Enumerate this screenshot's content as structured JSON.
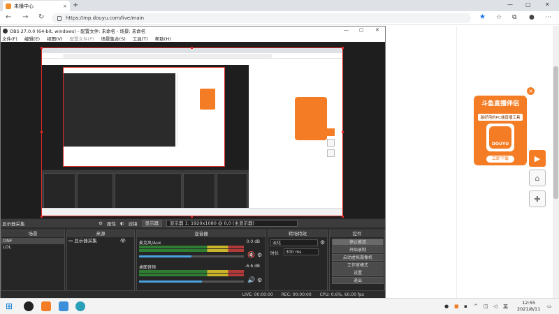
{
  "browser": {
    "tab_title": "未播中心",
    "url": "https://mp.douyu.com/live/main",
    "new_tab": "+",
    "tab_close": "×",
    "back": "←",
    "forward": "→",
    "reload": "↻",
    "star": "★"
  },
  "obs": {
    "title": "OBS 27.0.0 (64-bit, windows) - 配置文件: 未命名 - 场景: 未命名",
    "menu": [
      "文件(F)",
      "编辑(E)",
      "视图(V)",
      "配置文件(P)",
      "场景集合(S)",
      "工具(T)",
      "帮助(H)"
    ],
    "source_label": "显示器采集",
    "toolbar": {
      "properties": "属性",
      "filters": "滤镜",
      "display_label": "显示器",
      "display_value": "显示器 1: 1920x1080 @ 0,0 (主显示器)"
    },
    "scenes_header": "场景",
    "scenes": [
      "ONF",
      "LOL"
    ],
    "sources_header": "来源",
    "sources": [
      "显示器采集"
    ],
    "mixer_header": "混音器",
    "mixer": [
      {
        "name": "麦克风/Aux",
        "db": "0.0 dB",
        "level": 0.5
      },
      {
        "name": "桌面音频",
        "db": "-6.6 dB",
        "level": 0.6
      }
    ],
    "transitions_header": "转场特效",
    "transition_value": "淡化",
    "duration_label": "时长",
    "duration_value": "300 ms",
    "controls_header": "控件",
    "controls": [
      "停止推流",
      "开始录制",
      "启动虚拟摄像机",
      "工作室模式",
      "设置",
      "退出"
    ],
    "status": {
      "live": "LIVE: 00:00:00",
      "rec": "REC: 00:00:00",
      "cpu": "CPU: 0.6%, 60.00 fps"
    }
  },
  "promo": {
    "title": "斗鱼直播伴侣",
    "subtitle": "最好用的PC端直播工具",
    "logo_text": "DOUYU",
    "button": "立即下载",
    "close": "×"
  },
  "taskbar": {
    "time": "12:55",
    "date": "2021/8/11"
  },
  "colors": {
    "brand_orange": "#f47c24",
    "selection_red": "#e02a2a",
    "obs_dark": "#2b2b2b"
  }
}
